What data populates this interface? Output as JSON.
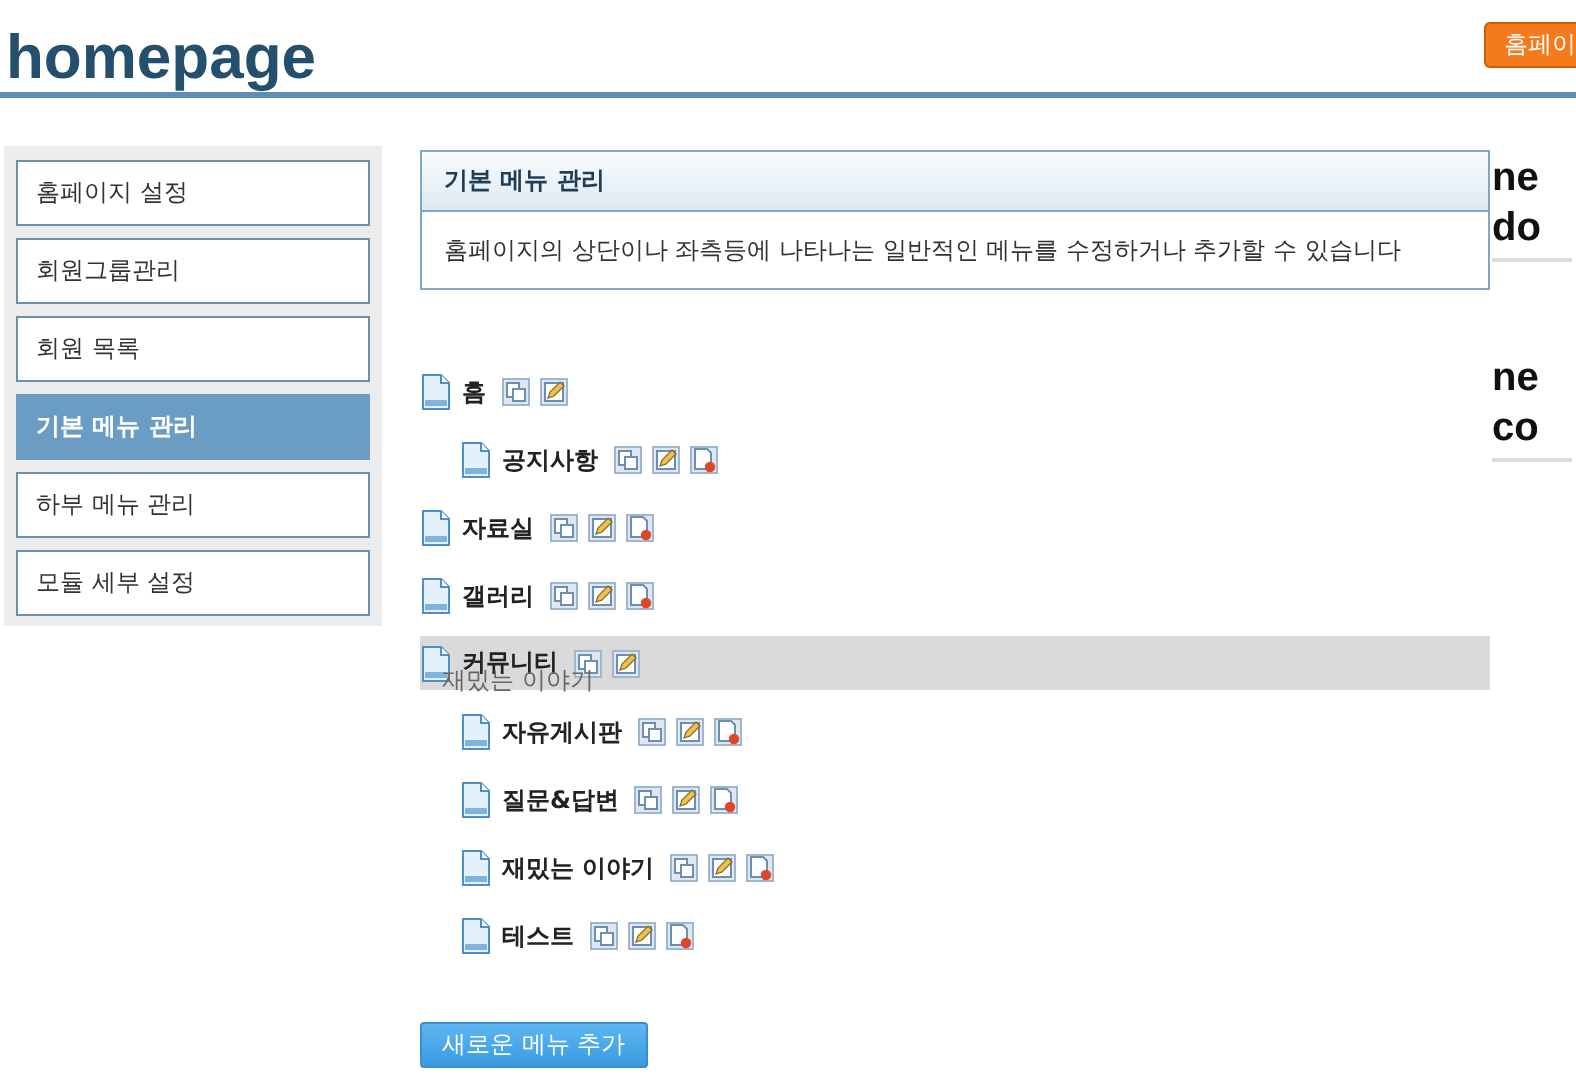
{
  "header": {
    "title": "homepage",
    "top_button": "홈페이"
  },
  "sidebar": {
    "items": [
      {
        "label": "홈페이지 설정",
        "selected": false
      },
      {
        "label": "회원그룹관리",
        "selected": false
      },
      {
        "label": "회원 목록",
        "selected": false
      },
      {
        "label": "기본 메뉴 관리",
        "selected": true
      },
      {
        "label": "하부 메뉴 관리",
        "selected": false
      },
      {
        "label": "모듈 세부 설정",
        "selected": false
      }
    ]
  },
  "info_box": {
    "title": "기본 메뉴 관리",
    "text": "홈페이지의 상단이나 좌측등에 나타나는 일반적인 메뉴를 수정하거나 추가할 수 있습니다"
  },
  "menu_tree": [
    {
      "label": "홈",
      "deletable": false,
      "highlighted": false,
      "children": [
        {
          "label": "공지사항",
          "deletable": true,
          "highlighted": false
        }
      ]
    },
    {
      "label": "자료실",
      "deletable": true,
      "highlighted": false
    },
    {
      "label": "갤러리",
      "deletable": true,
      "highlighted": false
    },
    {
      "label": "커뮤니티",
      "deletable": false,
      "highlighted": true,
      "drag_label": "재밌는 이야기",
      "children": [
        {
          "label": "자유게시판",
          "deletable": true,
          "highlighted": false
        },
        {
          "label": "질문&답변",
          "deletable": true,
          "highlighted": false
        },
        {
          "label": "재밌는 이야기",
          "deletable": true,
          "highlighted": false
        },
        {
          "label": "테스트",
          "deletable": true,
          "highlighted": false
        }
      ]
    }
  ],
  "add_button": "새로운 메뉴 추가",
  "right_panel": {
    "headings": [
      {
        "lines": [
          "ne",
          "do"
        ]
      },
      {
        "lines": [
          "ne",
          "co"
        ]
      }
    ]
  }
}
